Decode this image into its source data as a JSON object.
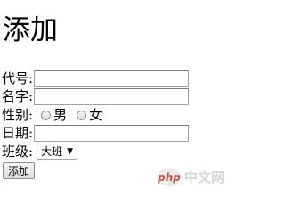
{
  "page": {
    "title": "添加"
  },
  "form": {
    "code_label": "代号:",
    "code_value": "",
    "name_label": "名字:",
    "name_value": "",
    "gender_label": "性别:",
    "gender_options": [
      "男",
      "女"
    ],
    "date_label": "日期:",
    "date_value": "",
    "class_label": "班级:",
    "class_selected": "大班",
    "submit_label": "添加"
  },
  "watermark": {
    "logo_text": "php",
    "site_text": "中文网"
  },
  "icons": {
    "select_caret": "chevron-down-icon"
  }
}
